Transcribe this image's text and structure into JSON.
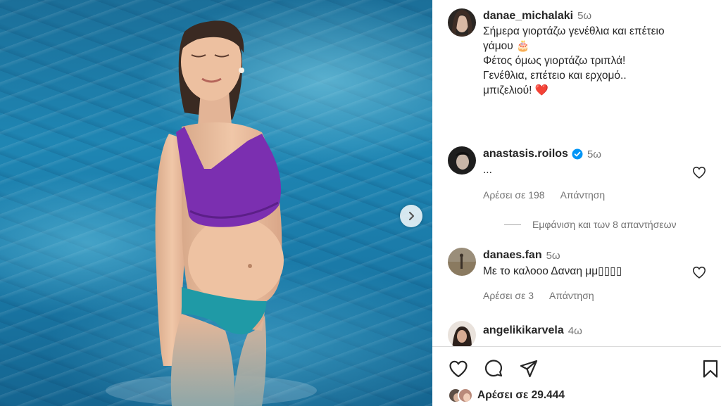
{
  "post": {
    "author": "danae_michalaki",
    "time": "5ω",
    "caption_lines": [
      "Σήμερα γιορτάζω γενέθλια και επέτειο",
      "γάμου 🎂",
      "Φέτος όμως γιορτάζω τριπλά!",
      "Γενέθλια, επέτειο και ερχομό..",
      "μπιζελιού! ❤️"
    ],
    "likes_text": "Αρέσει σε 29.444"
  },
  "comments": [
    {
      "user": "anastasis.roilos",
      "verified": true,
      "time": "5ω",
      "text": "...",
      "likes": "Αρέσει σε 198",
      "reply": "Απάντηση",
      "view_replies": "Εμφάνιση και των 8 απαντήσεων"
    },
    {
      "user": "danaes.fan",
      "time": "5ω",
      "text": "Με το καλοοο Δαναη μμ▯▯▯▯",
      "likes": "Αρέσει σε 3",
      "reply": "Απάντηση"
    },
    {
      "user": "angelikikarvela",
      "time": "4ω"
    }
  ],
  "icons": {
    "like": "heart-icon",
    "comment": "comment-icon",
    "share": "send-icon",
    "save": "bookmark-icon",
    "next": "chevron-right-icon",
    "verified": "verified-badge-icon"
  },
  "colors": {
    "verified": "#0095f6",
    "heart_red": "#ed1c24",
    "muted_text": "#737373"
  }
}
